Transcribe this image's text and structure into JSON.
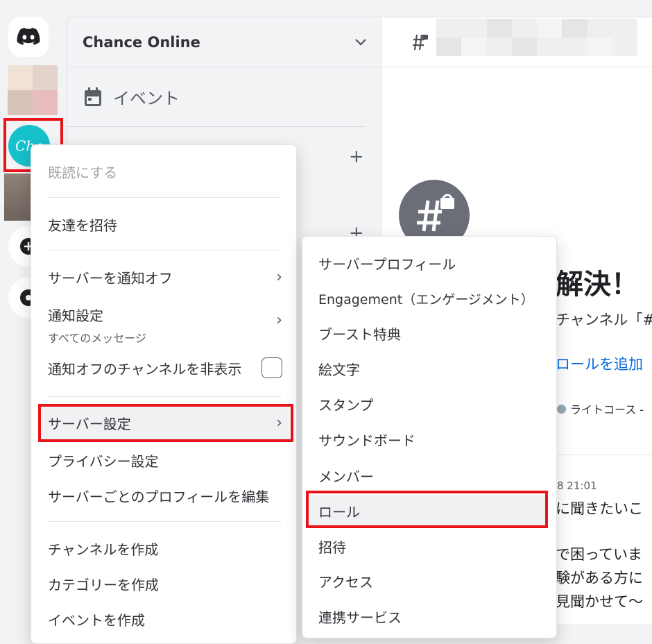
{
  "server": {
    "name": "Chance Online",
    "avatar_text": "Cha"
  },
  "sidebar": {
    "events_label": "イベント"
  },
  "main": {
    "welcome_title": "解決！",
    "welcome_sub": "チャンネル「#",
    "add_role_link": "ロールを追加",
    "role_pill": "ライトコース -",
    "message_time": "8 21:01",
    "message_lines": [
      "に聞きたいこ",
      "で困っていま",
      "験がある方に",
      "見聞かせて〜"
    ]
  },
  "context_menu": {
    "mark_read": "既読にする",
    "invite": "友達を招待",
    "mute_server": "サーバーを通知オフ",
    "notification_settings": "通知設定",
    "notification_sub": "すべてのメッセージ",
    "hide_muted": "通知オフのチャンネルを非表示",
    "server_settings": "サーバー設定",
    "privacy_settings": "プライバシー設定",
    "edit_profile": "サーバーごとのプロフィールを編集",
    "create_channel": "チャンネルを作成",
    "create_category": "カテゴリーを作成",
    "create_event": "イベントを作成"
  },
  "submenu": {
    "items": [
      "サーバープロフィール",
      "Engagement（エンゲージメント）",
      "ブースト特典",
      "絵文字",
      "スタンプ",
      "サウンドボード",
      "メンバー",
      "ロール",
      "招待",
      "アクセス",
      "連携サービス"
    ]
  },
  "colors": {
    "highlight_red": "#e8141a",
    "link_blue": "#0068e0",
    "avatar_teal": "#17c1cc"
  }
}
